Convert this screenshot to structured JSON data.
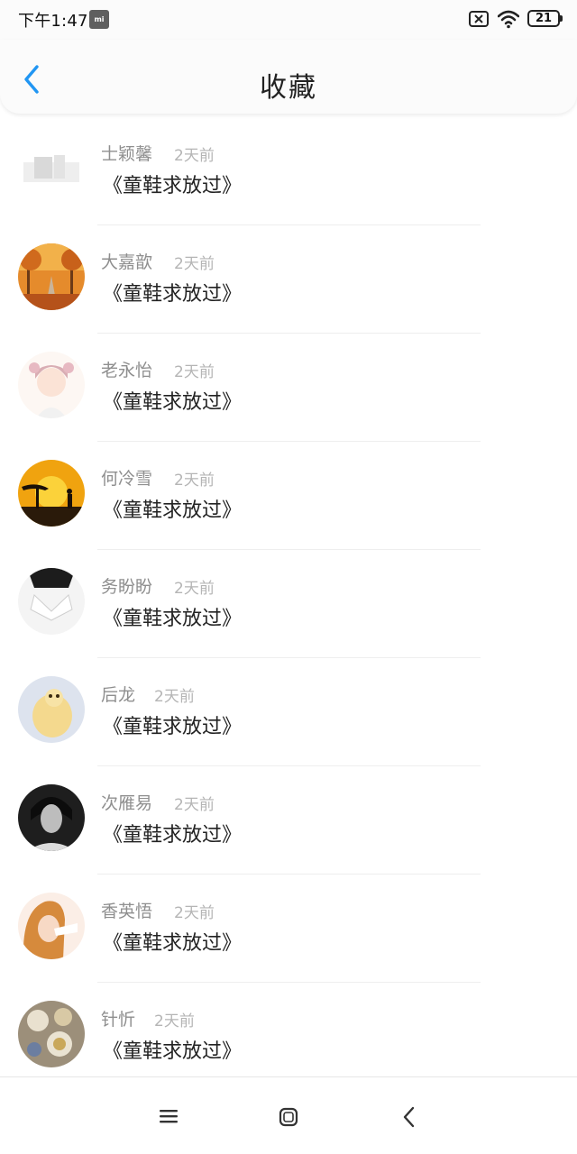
{
  "status_bar": {
    "time": "下午1:47",
    "notification_badge": "mi",
    "battery_level": "21",
    "icons": [
      "mi-notification-icon",
      "no-sim-icon",
      "wifi-icon",
      "battery-icon"
    ]
  },
  "header": {
    "title": "收藏",
    "back_icon": "chevron-left-icon",
    "accent_color": "#2196f3"
  },
  "favorites": [
    {
      "user": "士颖馨",
      "time": "2天前",
      "title": "《童鞋求放过》",
      "avatar": "faded-photo"
    },
    {
      "user": "大嘉歆",
      "time": "2天前",
      "title": "《童鞋求放过》",
      "avatar": "autumn-road"
    },
    {
      "user": "老永怡",
      "time": "2天前",
      "title": "《童鞋求放过》",
      "avatar": "anime-boy"
    },
    {
      "user": "何冷雪",
      "time": "2天前",
      "title": "《童鞋求放过》",
      "avatar": "sunset-silhouette"
    },
    {
      "user": "务盼盼",
      "time": "2天前",
      "title": "《童鞋求放过》",
      "avatar": "white-collar"
    },
    {
      "user": "后龙",
      "time": "2天前",
      "title": "《童鞋求放过》",
      "avatar": "golden-animal"
    },
    {
      "user": "次雁易",
      "time": "2天前",
      "title": "《童鞋求放过》",
      "avatar": "dark-portrait"
    },
    {
      "user": "香英悟",
      "time": "2天前",
      "title": "《童鞋求放过》",
      "avatar": "girl-portrait"
    },
    {
      "user": "针忻",
      "time": "2天前",
      "title": "《童鞋求放过》",
      "avatar": "tea-table"
    }
  ],
  "nav_bar": {
    "icons": [
      "menu-icon",
      "home-icon",
      "back-icon"
    ]
  }
}
